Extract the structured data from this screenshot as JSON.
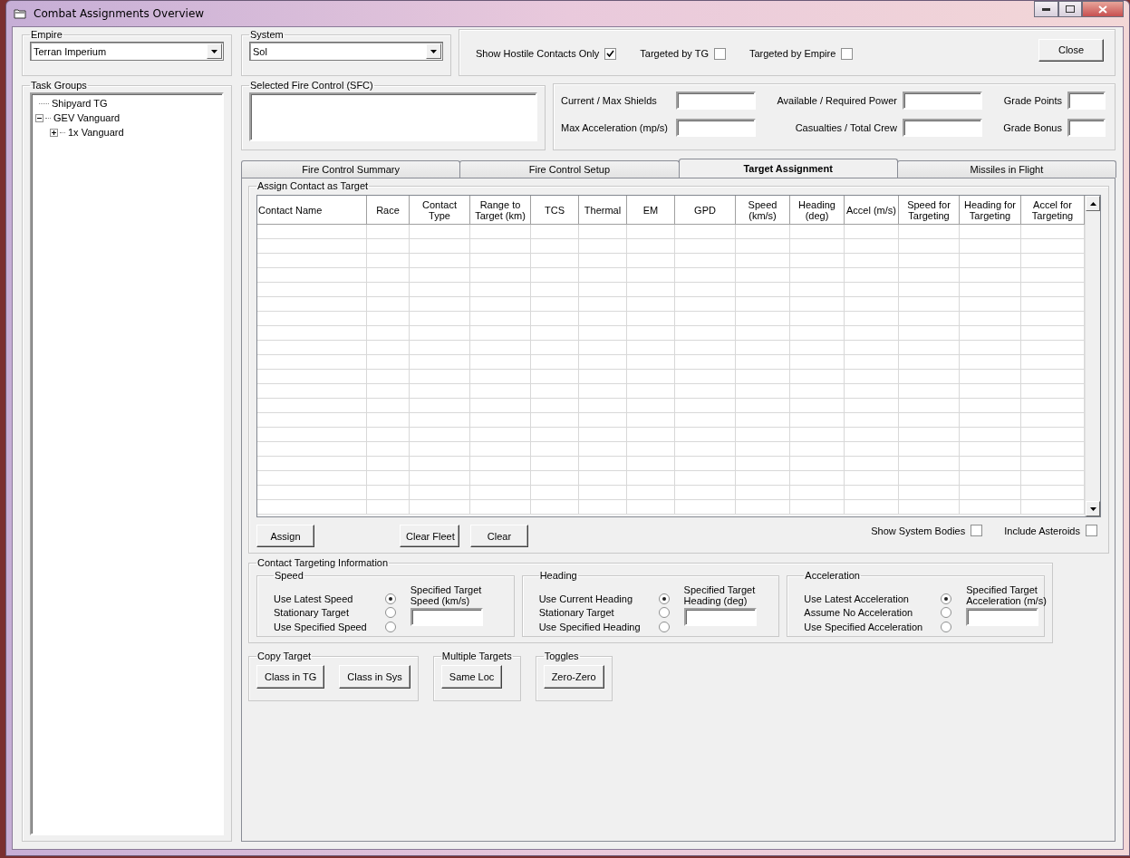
{
  "window": {
    "title": "Combat Assignments Overview"
  },
  "empire": {
    "label": "Empire",
    "value": "Terran Imperium"
  },
  "system": {
    "label": "System",
    "value": "Sol"
  },
  "filters": [
    {
      "label": "Show Hostile Contacts Only",
      "checked": true
    },
    {
      "label": "Targeted by TG",
      "checked": false
    },
    {
      "label": "Targeted by Empire",
      "checked": false
    }
  ],
  "close_button": "Close",
  "task_groups": {
    "label": "Task Groups",
    "items": [
      {
        "label": "Shipyard TG"
      },
      {
        "label": "GEV Vanguard",
        "expanded": true,
        "children": [
          {
            "label": "1x Vanguard",
            "expanded": false
          }
        ]
      }
    ]
  },
  "selected_fire_control": {
    "label": "Selected Fire Control (SFC)"
  },
  "stats": [
    {
      "label": "Current / Max Shields"
    },
    {
      "label": "Available / Required Power"
    },
    {
      "label": "Grade Points"
    },
    {
      "label": "Max Acceleration (mp/s)"
    },
    {
      "label": "Casualties / Total Crew"
    },
    {
      "label": "Grade Bonus"
    }
  ],
  "tabs": [
    {
      "label": "Fire Control Summary",
      "selected": false
    },
    {
      "label": "Fire Control Setup",
      "selected": false
    },
    {
      "label": "Target Assignment",
      "selected": true
    },
    {
      "label": "Missiles in Flight",
      "selected": false
    }
  ],
  "assign": {
    "label": "Assign Contact as Target",
    "columns": [
      "Contact Name",
      "Race",
      "Contact Type",
      "Range to Target (km)",
      "TCS",
      "Thermal",
      "EM",
      "GPD",
      "Speed (km/s)",
      "Heading (deg)",
      "Accel (m/s)",
      "Speed for Targeting",
      "Heading for Targeting",
      "Accel for Targeting"
    ],
    "buttons": [
      "Assign",
      "Clear Fleet",
      "Clear"
    ],
    "options": [
      {
        "label": "Show System Bodies",
        "checked": false
      },
      {
        "label": "Include Asteroids",
        "checked": false
      }
    ]
  },
  "targeting": {
    "label": "Contact Targeting Information",
    "groups": [
      {
        "label": "Speed",
        "field_label": "Specified Target Speed (km/s)",
        "options": [
          {
            "label": "Use Latest Speed",
            "selected": true
          },
          {
            "label": "Stationary Target",
            "selected": false
          },
          {
            "label": "Use Specified Speed",
            "selected": false
          }
        ]
      },
      {
        "label": "Heading",
        "field_label": "Specified Target Heading (deg)",
        "options": [
          {
            "label": "Use Current Heading",
            "selected": true
          },
          {
            "label": "Stationary Target",
            "selected": false
          },
          {
            "label": "Use Specified Heading",
            "selected": false
          }
        ]
      },
      {
        "label": "Acceleration",
        "field_label": "Specified Target Acceleration (m/s)",
        "options": [
          {
            "label": "Use Latest Acceleration",
            "selected": true
          },
          {
            "label": "Assume No Acceleration",
            "selected": false
          },
          {
            "label": "Use Specified Acceleration",
            "selected": false
          }
        ]
      }
    ]
  },
  "action_groups": [
    {
      "label": "Copy Target",
      "buttons": [
        "Class in TG",
        "Class in Sys"
      ]
    },
    {
      "label": "Multiple Targets",
      "buttons": [
        "Same Loc"
      ]
    },
    {
      "label": "Toggles",
      "buttons": [
        "Zero-Zero"
      ]
    }
  ]
}
